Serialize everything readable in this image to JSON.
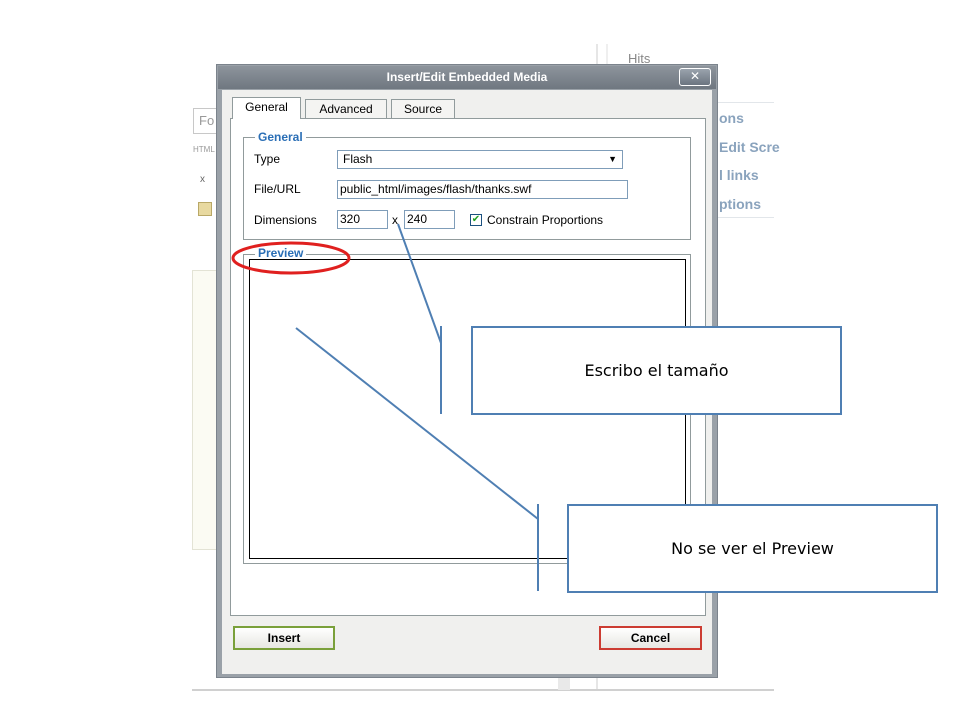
{
  "background": {
    "hits_label": "Hits",
    "editor_input_text": "Fo",
    "html_label": "HTML",
    "toolbar_glyph": "x",
    "right_panel_items": [
      "ons",
      "Edit Scre",
      "l links",
      "ptions"
    ]
  },
  "dialog": {
    "title": "Insert/Edit Embedded Media",
    "close_glyph": "✕",
    "tabs": [
      {
        "label": "General"
      },
      {
        "label": "Advanced"
      },
      {
        "label": "Source"
      }
    ],
    "general": {
      "legend": "General",
      "type_label": "Type",
      "type_value": "Flash",
      "file_label": "File/URL",
      "file_value": "public_html/images/flash/thanks.swf",
      "dimensions_label": "Dimensions",
      "width_value": "320",
      "separator": "x",
      "height_value": "240",
      "constrain_label": "Constrain Proportions",
      "constrain_checked": true
    },
    "preview": {
      "legend": "Preview"
    },
    "buttons": {
      "insert": "Insert",
      "cancel": "Cancel"
    }
  },
  "annotations": {
    "callout_size": "Escribo el tamaño",
    "callout_preview": "No se ver el Preview",
    "line_color": "#4f7fb3",
    "ellipse_color": "#e0201f"
  },
  "colors": {
    "legend_blue": "#2b6fb6",
    "insert_border": "#7aa03a",
    "cancel_border": "#cc3c32"
  }
}
